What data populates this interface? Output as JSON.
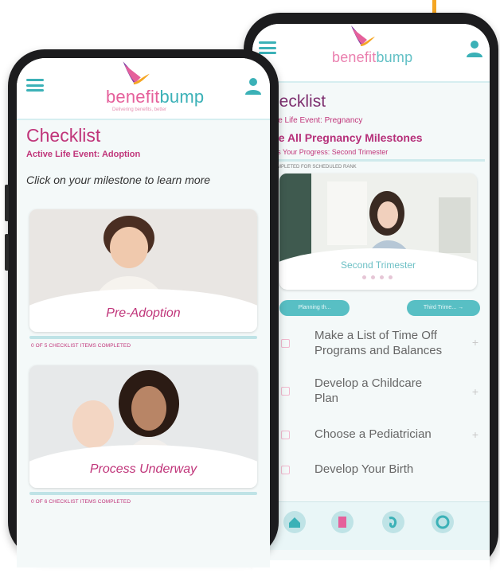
{
  "brand": {
    "name_part1": "benefit",
    "name_part2": "bump",
    "tagline": "Delivering benefits, better",
    "colors": {
      "pink": "#c0357a",
      "teal": "#3bb1b7",
      "accent": "#f5a623"
    }
  },
  "front_phone": {
    "header": {
      "menu_icon": "hamburger-icon",
      "user_icon": "user-icon"
    },
    "title": "Checklist",
    "active_event": "Active Life Event: Adoption",
    "hint": "Click on your milestone to learn more",
    "cards": [
      {
        "label": "Pre-Adoption",
        "progress": "0 OF 5 CHECKLIST ITEMS COMPLETED"
      },
      {
        "label": "Process Underway",
        "progress": "0 OF 6 CHECKLIST ITEMS COMPLETED"
      }
    ]
  },
  "back_phone": {
    "title": "hecklist",
    "active_event": "ive Life Event: Pregnancy",
    "see_all": "ee All Pregnancy Milestones",
    "progress": "k's Your Progress: Second Trimester",
    "completed_note": "COMPLETED FOR SCHEDULED RANK",
    "card_label": "Second Trimester",
    "prev_button": "Planning th...",
    "next_button": "Third Trime...",
    "next_arrow": "→",
    "tasks": [
      {
        "text": "Make a List of Time Off Programs and Balances"
      },
      {
        "text": "Develop a Childcare Plan"
      },
      {
        "text": "Choose a Pediatrician"
      },
      {
        "text": "Develop Your Birth"
      }
    ],
    "plus_glyph": "+",
    "tabs": [
      "home-icon",
      "document-icon",
      "health-icon",
      "support-icon"
    ]
  }
}
